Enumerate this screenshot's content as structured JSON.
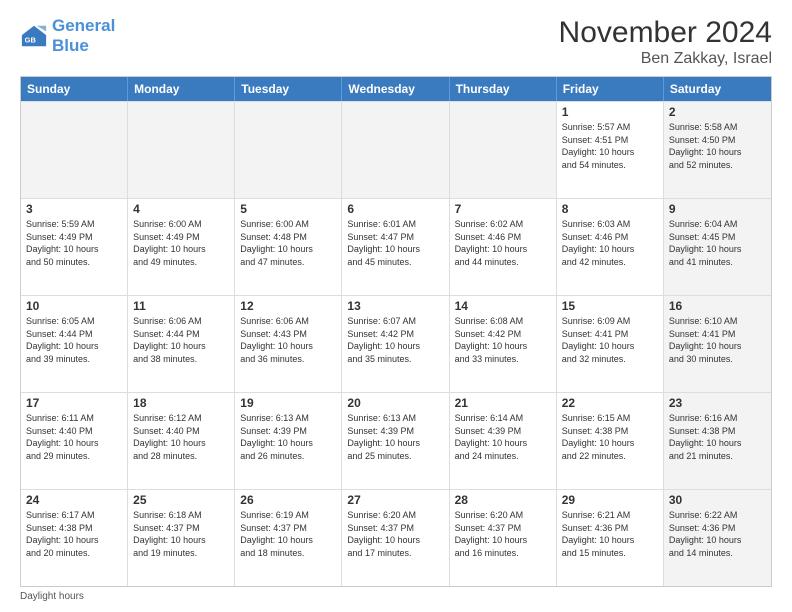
{
  "logo": {
    "line1": "General",
    "line2": "Blue"
  },
  "title": "November 2024",
  "location": "Ben Zakkay, Israel",
  "days_of_week": [
    "Sunday",
    "Monday",
    "Tuesday",
    "Wednesday",
    "Thursday",
    "Friday",
    "Saturday"
  ],
  "footer_label": "Daylight hours",
  "weeks": [
    [
      {
        "num": "",
        "info": "",
        "shaded": true
      },
      {
        "num": "",
        "info": "",
        "shaded": true
      },
      {
        "num": "",
        "info": "",
        "shaded": true
      },
      {
        "num": "",
        "info": "",
        "shaded": true
      },
      {
        "num": "",
        "info": "",
        "shaded": true
      },
      {
        "num": "1",
        "info": "Sunrise: 5:57 AM\nSunset: 4:51 PM\nDaylight: 10 hours\nand 54 minutes.",
        "shaded": false
      },
      {
        "num": "2",
        "info": "Sunrise: 5:58 AM\nSunset: 4:50 PM\nDaylight: 10 hours\nand 52 minutes.",
        "shaded": true
      }
    ],
    [
      {
        "num": "3",
        "info": "Sunrise: 5:59 AM\nSunset: 4:49 PM\nDaylight: 10 hours\nand 50 minutes.",
        "shaded": false
      },
      {
        "num": "4",
        "info": "Sunrise: 6:00 AM\nSunset: 4:49 PM\nDaylight: 10 hours\nand 49 minutes.",
        "shaded": false
      },
      {
        "num": "5",
        "info": "Sunrise: 6:00 AM\nSunset: 4:48 PM\nDaylight: 10 hours\nand 47 minutes.",
        "shaded": false
      },
      {
        "num": "6",
        "info": "Sunrise: 6:01 AM\nSunset: 4:47 PM\nDaylight: 10 hours\nand 45 minutes.",
        "shaded": false
      },
      {
        "num": "7",
        "info": "Sunrise: 6:02 AM\nSunset: 4:46 PM\nDaylight: 10 hours\nand 44 minutes.",
        "shaded": false
      },
      {
        "num": "8",
        "info": "Sunrise: 6:03 AM\nSunset: 4:46 PM\nDaylight: 10 hours\nand 42 minutes.",
        "shaded": false
      },
      {
        "num": "9",
        "info": "Sunrise: 6:04 AM\nSunset: 4:45 PM\nDaylight: 10 hours\nand 41 minutes.",
        "shaded": true
      }
    ],
    [
      {
        "num": "10",
        "info": "Sunrise: 6:05 AM\nSunset: 4:44 PM\nDaylight: 10 hours\nand 39 minutes.",
        "shaded": false
      },
      {
        "num": "11",
        "info": "Sunrise: 6:06 AM\nSunset: 4:44 PM\nDaylight: 10 hours\nand 38 minutes.",
        "shaded": false
      },
      {
        "num": "12",
        "info": "Sunrise: 6:06 AM\nSunset: 4:43 PM\nDaylight: 10 hours\nand 36 minutes.",
        "shaded": false
      },
      {
        "num": "13",
        "info": "Sunrise: 6:07 AM\nSunset: 4:42 PM\nDaylight: 10 hours\nand 35 minutes.",
        "shaded": false
      },
      {
        "num": "14",
        "info": "Sunrise: 6:08 AM\nSunset: 4:42 PM\nDaylight: 10 hours\nand 33 minutes.",
        "shaded": false
      },
      {
        "num": "15",
        "info": "Sunrise: 6:09 AM\nSunset: 4:41 PM\nDaylight: 10 hours\nand 32 minutes.",
        "shaded": false
      },
      {
        "num": "16",
        "info": "Sunrise: 6:10 AM\nSunset: 4:41 PM\nDaylight: 10 hours\nand 30 minutes.",
        "shaded": true
      }
    ],
    [
      {
        "num": "17",
        "info": "Sunrise: 6:11 AM\nSunset: 4:40 PM\nDaylight: 10 hours\nand 29 minutes.",
        "shaded": false
      },
      {
        "num": "18",
        "info": "Sunrise: 6:12 AM\nSunset: 4:40 PM\nDaylight: 10 hours\nand 28 minutes.",
        "shaded": false
      },
      {
        "num": "19",
        "info": "Sunrise: 6:13 AM\nSunset: 4:39 PM\nDaylight: 10 hours\nand 26 minutes.",
        "shaded": false
      },
      {
        "num": "20",
        "info": "Sunrise: 6:13 AM\nSunset: 4:39 PM\nDaylight: 10 hours\nand 25 minutes.",
        "shaded": false
      },
      {
        "num": "21",
        "info": "Sunrise: 6:14 AM\nSunset: 4:39 PM\nDaylight: 10 hours\nand 24 minutes.",
        "shaded": false
      },
      {
        "num": "22",
        "info": "Sunrise: 6:15 AM\nSunset: 4:38 PM\nDaylight: 10 hours\nand 22 minutes.",
        "shaded": false
      },
      {
        "num": "23",
        "info": "Sunrise: 6:16 AM\nSunset: 4:38 PM\nDaylight: 10 hours\nand 21 minutes.",
        "shaded": true
      }
    ],
    [
      {
        "num": "24",
        "info": "Sunrise: 6:17 AM\nSunset: 4:38 PM\nDaylight: 10 hours\nand 20 minutes.",
        "shaded": false
      },
      {
        "num": "25",
        "info": "Sunrise: 6:18 AM\nSunset: 4:37 PM\nDaylight: 10 hours\nand 19 minutes.",
        "shaded": false
      },
      {
        "num": "26",
        "info": "Sunrise: 6:19 AM\nSunset: 4:37 PM\nDaylight: 10 hours\nand 18 minutes.",
        "shaded": false
      },
      {
        "num": "27",
        "info": "Sunrise: 6:20 AM\nSunset: 4:37 PM\nDaylight: 10 hours\nand 17 minutes.",
        "shaded": false
      },
      {
        "num": "28",
        "info": "Sunrise: 6:20 AM\nSunset: 4:37 PM\nDaylight: 10 hours\nand 16 minutes.",
        "shaded": false
      },
      {
        "num": "29",
        "info": "Sunrise: 6:21 AM\nSunset: 4:36 PM\nDaylight: 10 hours\nand 15 minutes.",
        "shaded": false
      },
      {
        "num": "30",
        "info": "Sunrise: 6:22 AM\nSunset: 4:36 PM\nDaylight: 10 hours\nand 14 minutes.",
        "shaded": true
      }
    ]
  ]
}
